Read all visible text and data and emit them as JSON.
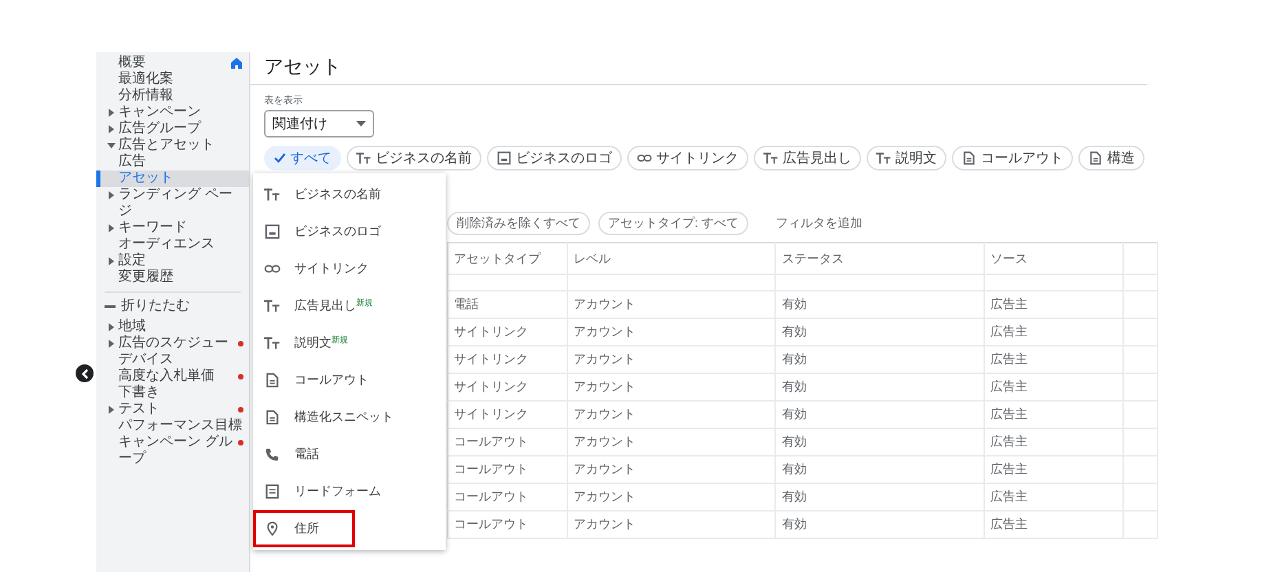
{
  "sidebar": {
    "overview": {
      "label": "概要"
    },
    "items": [
      {
        "label": "最適化案",
        "selected": false
      },
      {
        "label": "分析情報",
        "selected": false
      },
      {
        "label": "キャンペーン",
        "expanded": false,
        "selected": false
      },
      {
        "label": "広告グループ",
        "expanded": false,
        "selected": false
      },
      {
        "label": "広告とアセット",
        "expanded": true,
        "selected": false,
        "children": [
          {
            "label": "広告",
            "selected": false
          },
          {
            "label": "アセット",
            "selected": true
          }
        ]
      },
      {
        "label": "ランディング ページ",
        "expanded": false,
        "selected": false
      },
      {
        "label": "キーワード",
        "expanded": false,
        "selected": false
      },
      {
        "label": "オーディエンス",
        "selected": false
      },
      {
        "label": "設定",
        "expanded": false,
        "selected": false
      },
      {
        "label": "変更履歴",
        "selected": false
      }
    ],
    "collapse": {
      "label": "折りたたむ"
    },
    "more_items": [
      {
        "label": "地域",
        "expanded": false,
        "alert": false,
        "selected": false
      },
      {
        "label": "広告のスケジュー",
        "expanded": false,
        "alert": true,
        "selected": false
      },
      {
        "label": "デバイス",
        "alert": false,
        "selected": false
      },
      {
        "label": "高度な入札単価",
        "alert": true,
        "selected": false
      },
      {
        "label": "下書き",
        "alert": false,
        "selected": false
      },
      {
        "label": "テスト",
        "expanded": false,
        "alert": true,
        "selected": false
      },
      {
        "label": "パフォーマンス目標",
        "alert": false,
        "selected": false
      },
      {
        "label": "キャンペーン グループ",
        "alert": true,
        "selected": false
      }
    ]
  },
  "main": {
    "title": "アセット",
    "view": {
      "label": "表を表示",
      "value": "関連付け"
    },
    "chips": [
      {
        "label": "すべて",
        "kind": "plain",
        "selected": true
      },
      {
        "label": "ビジネスの名前",
        "kind": "text",
        "selected": false
      },
      {
        "label": "ビジネスのロゴ",
        "kind": "image",
        "selected": false
      },
      {
        "label": "サイトリンク",
        "kind": "link",
        "selected": false
      },
      {
        "label": "広告見出し",
        "kind": "text",
        "selected": false
      },
      {
        "label": "説明文",
        "kind": "text",
        "selected": false
      },
      {
        "label": "コールアウト",
        "kind": "doc",
        "selected": false
      },
      {
        "label": "構造",
        "kind": "doc",
        "selected": false
      }
    ],
    "filters": [
      {
        "label": "削除済みを除くすべて"
      },
      {
        "label": "アセットタイプ: すべて"
      }
    ],
    "add_filter": "フィルタを追加",
    "table": {
      "columns": [
        "アセットタイプ",
        "レベル",
        "ステータス",
        "ソース"
      ],
      "rows": [
        [
          "電話",
          "アカウント",
          "有効",
          "広告主"
        ],
        [
          "サイトリンク",
          "アカウント",
          "有効",
          "広告主"
        ],
        [
          "サイトリンク",
          "アカウント",
          "有効",
          "広告主"
        ],
        [
          "サイトリンク",
          "アカウント",
          "有効",
          "広告主"
        ],
        [
          "サイトリンク",
          "アカウント",
          "有効",
          "広告主"
        ],
        [
          "コールアウト",
          "アカウント",
          "有効",
          "広告主"
        ],
        [
          "コールアウト",
          "アカウント",
          "有効",
          "広告主"
        ],
        [
          "コールアウト",
          "アカウント",
          "有効",
          "広告主"
        ],
        [
          "コールアウト",
          "アカウント",
          "有効",
          "広告主"
        ]
      ]
    },
    "menu": [
      {
        "label": "ビジネスの名前",
        "kind": "text",
        "highlighted": false
      },
      {
        "label": "ビジネスのロゴ",
        "kind": "image",
        "highlighted": false
      },
      {
        "label": "サイトリンク",
        "kind": "link",
        "highlighted": false
      },
      {
        "label": "広告見出し",
        "kind": "text",
        "badge": "新規",
        "highlighted": false
      },
      {
        "label": "説明文",
        "kind": "text",
        "badge": "新規",
        "highlighted": false
      },
      {
        "label": "コールアウト",
        "kind": "doc",
        "highlighted": false
      },
      {
        "label": "構造化スニペット",
        "kind": "doc",
        "highlighted": false
      },
      {
        "label": "電話",
        "kind": "phone",
        "highlighted": false
      },
      {
        "label": "リードフォーム",
        "kind": "form",
        "highlighted": false
      },
      {
        "label": "住所",
        "kind": "location",
        "highlighted": true
      }
    ]
  }
}
